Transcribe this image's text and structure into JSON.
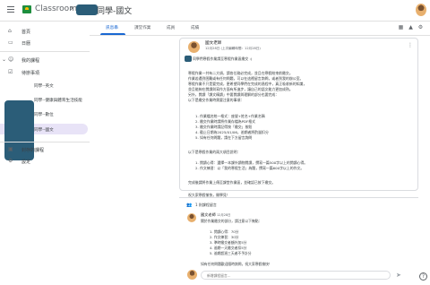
{
  "header": {
    "app_title": "Classroom",
    "breadcrumb_separator": "›",
    "course_title": "同學-國文"
  },
  "sidebar": {
    "home": {
      "label": "首頁",
      "icon": "home-icon"
    },
    "calendar": {
      "label": "日曆",
      "icon": "calendar-icon"
    },
    "enrolled": {
      "label": "我的課程",
      "icon": "people-icon",
      "collapse_glyph": "⌄"
    },
    "todo": {
      "label": "待辦事項",
      "icon": "checklist-icon"
    },
    "courses": [
      {
        "label": "同學--英文",
        "selected": false
      },
      {
        "label": "同學--健康與體育生活技能",
        "selected": false
      },
      {
        "label": "同學--數位",
        "selected": false
      },
      {
        "label": "同學--國文",
        "selected": true
      }
    ],
    "archived": {
      "label": "封存的課程",
      "icon": "archive-icon"
    },
    "settings": {
      "label": "設定",
      "icon": "gear-icon"
    }
  },
  "tabs": [
    {
      "label": "訊息串",
      "active": true
    },
    {
      "label": "課堂作業",
      "active": false
    },
    {
      "label": "成員",
      "active": false
    },
    {
      "label": "成績",
      "active": false
    }
  ],
  "toolbar": {
    "calendar_glyph": "▦",
    "drive_glyph": "▲",
    "settings_glyph": "⚙"
  },
  "post": {
    "author": "國文老師",
    "date": "12月28日 (上次編輯時間：12月28日)",
    "more_glyph": "⋮",
    "lines": [
      "同學們寒假作業請至寒假作業區繳交 :)",
      "",
      "寒假作業一共有二大項，請各位務必完成，並且在寒假結束前繳交。",
      "作業若遇到困難或有任何問題，可以在這裡留言詢問，或者到我的辦公室。",
      "寒假作業不只是要完成，更希望同學們在完成的過程中，真正吸收新的知識，",
      "並且能夠在閱讀與寫作方面有所進步，讓自己的語文能力更加成熟。",
      "另外，閱讀「課文精讀」中要閱讀與理解的部分也要完成：",
      "以下是繳交作業時需要注意的事項：",
      "",
      "1. 作業檔名統一格式：座號+姓名+作業名稱",
      "2. 繳交作業時請將作業存檔為PDF格式",
      "3. 繳交作業時請記得按「繳交」按鈕",
      "4. 截止日期為2025/01/06，逾期者將酌量扣分",
      "5. 如有任何問題，請在下方留言詢問",
      "",
      "以下是寒假作業的兩大項目說明：",
      "",
      "1. 閱讀心得：選擇一本課外讀物閱讀，撰寫一篇500字以上的閱讀心得。",
      "2. 作文練習：以「我的寒假生活」為題，撰寫一篇600字以上的作文。",
      "",
      "完成後請將作業上傳至課堂作業區，並確認已按下繳交。",
      "",
      "祝大家寒假愉快，開學見！"
    ]
  },
  "comments": {
    "icon": "comment-icon",
    "count_label": "1 則課程留言",
    "author": "國文老師",
    "date": "12月28日",
    "lines": [
      "關於作業繳交的部分，請注意以下幾點：",
      "",
      "1. 閱讀心得：70分",
      "2. 作文練習：30分",
      "3. 準時繳交者額外加5分",
      "4. 逾期一天繳交者扣5分",
      "5. 逾期超過三天者不予計分",
      "",
      "如有任何問題歡迎隨時詢問，祝大家寒假愉快！"
    ],
    "reply_placeholder": "新增課程留言...",
    "send_glyph": "➤"
  },
  "help_glyph": "?",
  "colors": {
    "accent": "#1967d2",
    "selected_bg": "#e8e3f7",
    "logo_green": "#1e8e3e",
    "mask": "#2b5d78"
  }
}
